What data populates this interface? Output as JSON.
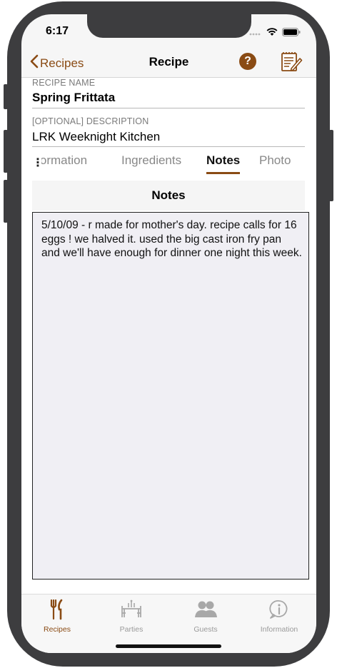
{
  "status_bar": {
    "time": "6:17"
  },
  "nav": {
    "back_label": "Recipes",
    "title": "Recipe",
    "help_label": "?"
  },
  "recipe": {
    "name_label": "RECIPE NAME",
    "name_value": "Spring Frittata",
    "description_label": "[OPTIONAL] DESCRIPTION",
    "description_value": "LRK Weeknight Kitchen"
  },
  "segments": {
    "more": "⋮",
    "items": [
      {
        "label": "Information"
      },
      {
        "label": "Ingredients"
      },
      {
        "label": "Notes"
      },
      {
        "label": "Photo"
      }
    ],
    "selected": "Notes"
  },
  "notes": {
    "header": "Notes",
    "text": "5/10/09 - r made for mother's day. recipe calls for 16 eggs ! we halved it. used the big cast iron fry pan and we'll have enough for dinner one night this week."
  },
  "tab_bar": {
    "items": [
      {
        "label": "Recipes",
        "icon": "fork-knife-icon"
      },
      {
        "label": "Parties",
        "icon": "dining-table-icon"
      },
      {
        "label": "Guests",
        "icon": "people-icon"
      },
      {
        "label": "Information",
        "icon": "info-bubble-icon"
      }
    ],
    "selected": "Recipes"
  },
  "colors": {
    "accent": "#8a4b14",
    "inactive": "#9a9a9a",
    "notes_bg": "#f0eff4"
  }
}
